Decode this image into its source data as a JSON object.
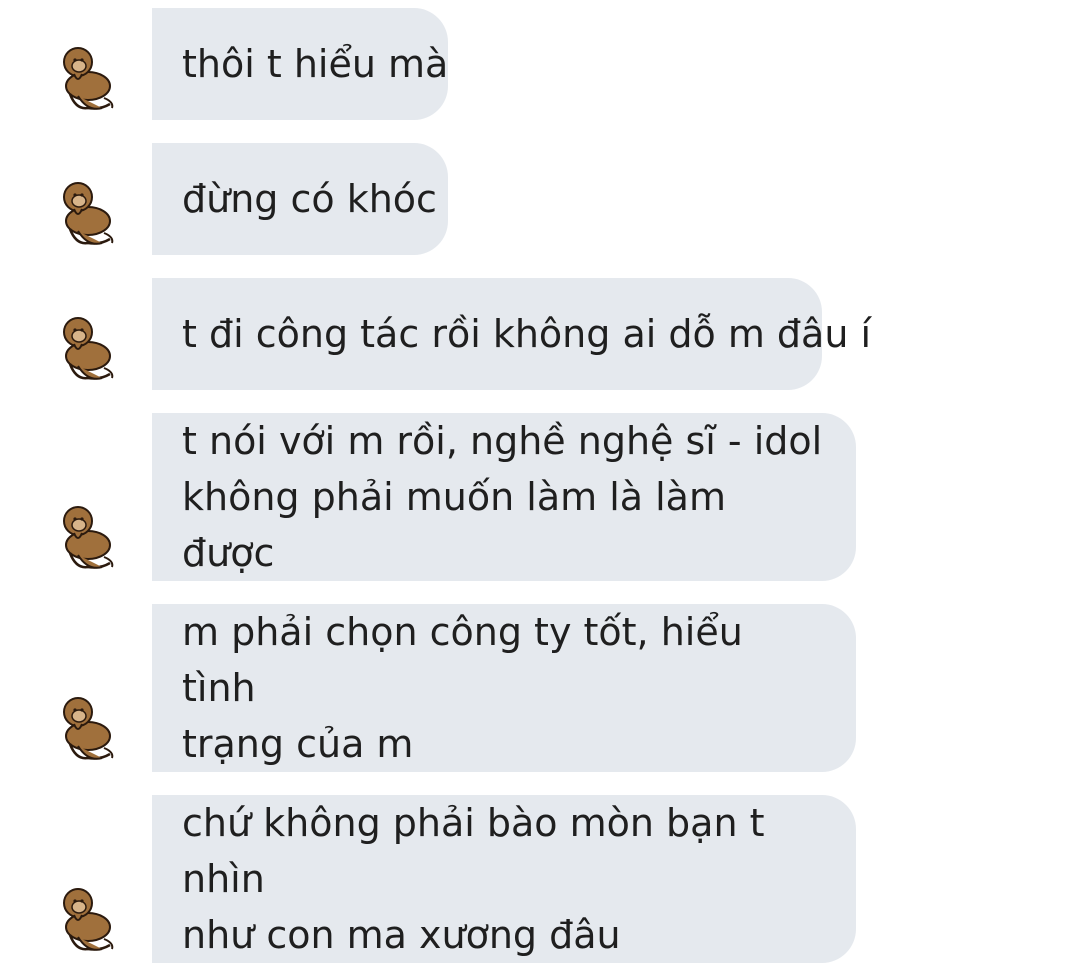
{
  "messages": [
    {
      "text": "thôi t hiểu mà",
      "avatar_icon": "monkey-sticker-icon"
    },
    {
      "text": "đừng có khóc",
      "avatar_icon": "monkey-sticker-icon"
    },
    {
      "text": "t đi công tác rồi không ai dỗ m đâu í",
      "avatar_icon": "monkey-sticker-icon"
    },
    {
      "text": "t nói với m rồi, nghề nghệ sĩ - idol\nkhông phải muốn làm là làm được",
      "avatar_icon": "monkey-sticker-icon"
    },
    {
      "text": "m phải chọn công ty tốt, hiểu tình\ntrạng của m",
      "avatar_icon": "monkey-sticker-icon"
    },
    {
      "text": "chứ không phải bào mòn bạn t nhìn\nnhư con ma xương đâu",
      "avatar_icon": "monkey-sticker-icon"
    }
  ],
  "colors": {
    "bubble_bg": "#e5e9ee",
    "text": "#1f1f1f",
    "avatar_fur": "#a0703c",
    "avatar_outline": "#2b1a0e"
  }
}
